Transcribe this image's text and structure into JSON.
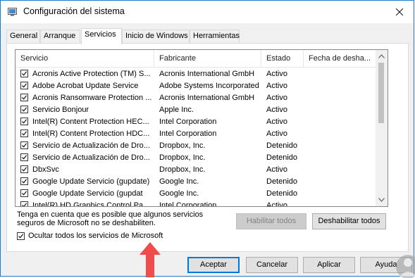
{
  "window": {
    "title": "Configuración del sistema",
    "accent": "#1979ca"
  },
  "tabs": [
    {
      "label": "General",
      "active": false
    },
    {
      "label": "Arranque",
      "active": false
    },
    {
      "label": "Servicios",
      "active": true
    },
    {
      "label": "Inicio de Windows",
      "active": false
    },
    {
      "label": "Herramientas",
      "active": false
    }
  ],
  "services_table": {
    "columns": [
      "Servicio",
      "Fabricante",
      "Estado",
      "Fecha de desha..."
    ],
    "rows": [
      {
        "checked": true,
        "name": "Acronis Active Protection (TM) S...",
        "vendor": "Acronis International GmbH",
        "status": "Activo",
        "disabled_date": ""
      },
      {
        "checked": true,
        "name": "Adobe Acrobat Update Service",
        "vendor": "Adobe Systems Incorporated",
        "status": "Activo",
        "disabled_date": ""
      },
      {
        "checked": true,
        "name": "Acronis Ransomware Protection ...",
        "vendor": "Acronis International GmbH",
        "status": "Activo",
        "disabled_date": ""
      },
      {
        "checked": true,
        "name": "Servicio Bonjour",
        "vendor": "Apple Inc.",
        "status": "Activo",
        "disabled_date": ""
      },
      {
        "checked": true,
        "name": "Intel(R) Content Protection HEC...",
        "vendor": "Intel Corporation",
        "status": "Activo",
        "disabled_date": ""
      },
      {
        "checked": true,
        "name": "Intel(R) Content Protection HDC...",
        "vendor": "Intel Corporation",
        "status": "Activo",
        "disabled_date": ""
      },
      {
        "checked": true,
        "name": "Servicio de Actualización de Dro...",
        "vendor": "Dropbox, Inc.",
        "status": "Detenido",
        "disabled_date": ""
      },
      {
        "checked": true,
        "name": "Servicio de Actualización de Dro...",
        "vendor": "Dropbox, Inc.",
        "status": "Detenido",
        "disabled_date": ""
      },
      {
        "checked": true,
        "name": "DbxSvc",
        "vendor": "Dropbox, Inc.",
        "status": "Activo",
        "disabled_date": ""
      },
      {
        "checked": true,
        "name": "Google Update Servicio (gupdate)",
        "vendor": "Google Inc.",
        "status": "Detenido",
        "disabled_date": ""
      },
      {
        "checked": true,
        "name": "Google Update Servicio (gupdat",
        "vendor": "Google Inc.",
        "status": "Detenido",
        "disabled_date": ""
      },
      {
        "checked": true,
        "name": "Intel(R) HD Graphics Control Pa...",
        "vendor": "Intel Corporation",
        "status": "Activo",
        "disabled_date": ""
      }
    ]
  },
  "note": "Tenga en cuenta que es posible que algunos servicios seguros de Microsoft no se deshabiliten.",
  "enable_all_label": "Habilitar todos",
  "disable_all_label": "Deshabilitar todos",
  "hide_ms_label": "Ocultar todos los servicios de Microsoft",
  "hide_ms_checked": true,
  "buttons": {
    "ok": "Aceptar",
    "cancel": "Cancelar",
    "apply": "Aplicar",
    "help": "Ayuda"
  },
  "annotation": {
    "icon": "red-arrow-up-icon",
    "color": "#f04c4c"
  }
}
